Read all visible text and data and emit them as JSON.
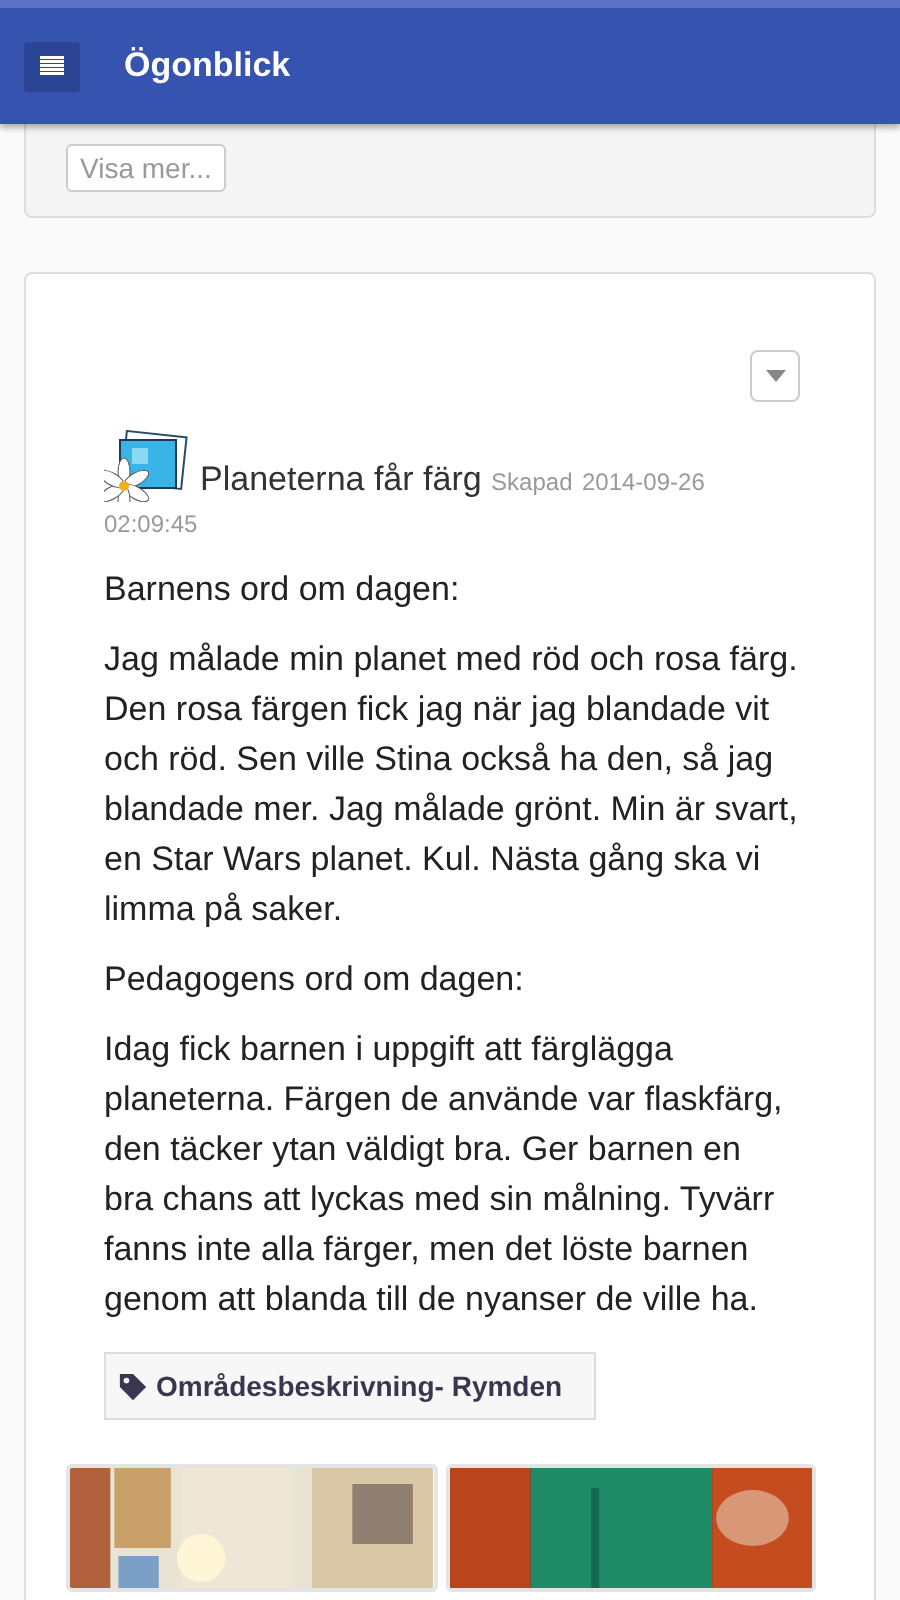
{
  "header": {
    "title": "Ögonblick"
  },
  "previous_card": {
    "more_button": "Visa mer..."
  },
  "post": {
    "title": "Planeterna får färg",
    "created_label": "Skapad",
    "created_date": "2014-09-26",
    "created_time": "02:09:45",
    "paragraphs": [
      "Barnens ord om dagen:",
      "Jag målade min planet med röd och rosa färg. Den rosa färgen fick jag när jag blandade vit och röd. Sen ville Stina också ha den, så jag blandade mer. Jag målade grönt. Min är svart, en Star Wars planet. Kul. Nästa gång ska vi limma på saker.",
      "Pedagogens ord om dagen:",
      "Idag fick barnen i uppgift att färglägga planeterna. Färgen de använde var flaskfärg, den täcker ytan väldigt bra. Ger barnen en bra chans att lyckas med sin målning. Tyvärr fanns inte alla färger, men det löste barnen genom att blanda till de nyanser de ville ha."
    ],
    "tag": "Områdesbeskrivning- Rymden"
  }
}
